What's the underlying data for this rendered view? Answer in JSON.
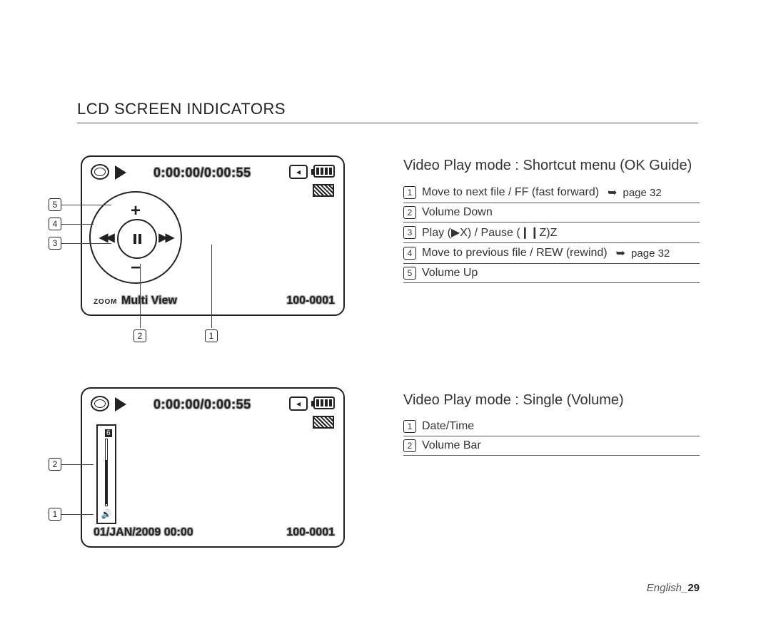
{
  "title": "LCD SCREEN INDICATORS",
  "lcd_top": {
    "time": "0:00:00/0:00:55",
    "zoom_label": "ZOOM",
    "multi_view": "Multi View",
    "file_number": "100-0001"
  },
  "lcd_bottom": {
    "time": "0:00:00/0:00:55",
    "datetime": "01/JAN/2009 00:00",
    "file_number": "100-0001",
    "volume_level": "6"
  },
  "section1": {
    "heading": "Video Play mode : Shortcut menu (OK Guide)",
    "items": [
      {
        "n": "1",
        "text": "Move to next file / FF (fast forward)",
        "page": "page 32"
      },
      {
        "n": "2",
        "text": "Volume Down",
        "page": ""
      },
      {
        "n": "3",
        "text": "Play (▶X) / Pause (❙❙Z)Z",
        "page": ""
      },
      {
        "n": "4",
        "text": "Move to previous file / REW (rewind)",
        "page": "page 32"
      },
      {
        "n": "5",
        "text": "Volume Up",
        "page": ""
      }
    ]
  },
  "section2": {
    "heading": "Video Play mode : Single (Volume)",
    "items": [
      {
        "n": "1",
        "text": "Date/Time"
      },
      {
        "n": "2",
        "text": "Volume Bar"
      }
    ]
  },
  "callouts_top": [
    "5",
    "4",
    "3",
    "2",
    "1"
  ],
  "callouts_bottom": [
    "2",
    "1"
  ],
  "footer": {
    "lang": "English",
    "sep": "_",
    "page": "29"
  }
}
